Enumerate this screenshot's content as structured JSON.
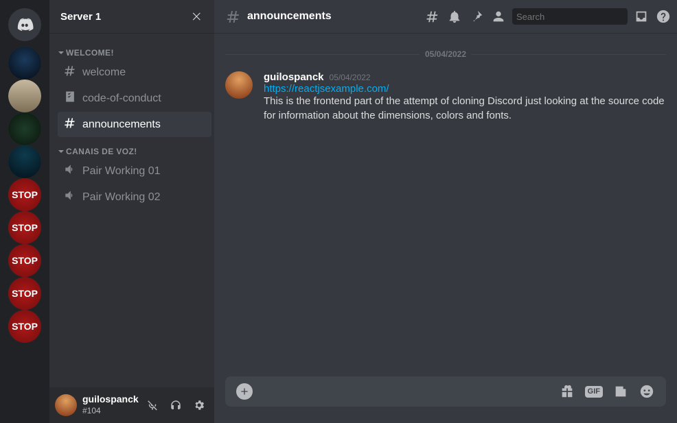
{
  "rail": {
    "home_icon": "discord-logo",
    "servers": [
      {
        "name": "server-1",
        "style": "r1",
        "label": ""
      },
      {
        "name": "server-2",
        "style": "r2",
        "label": ""
      },
      {
        "name": "server-3",
        "style": "r3",
        "label": ""
      },
      {
        "name": "server-4",
        "style": "r4",
        "label": ""
      },
      {
        "name": "server-5",
        "style": "stop",
        "label": "STOP"
      },
      {
        "name": "server-6",
        "style": "stop",
        "label": "STOP"
      },
      {
        "name": "server-7",
        "style": "stop",
        "label": "STOP"
      },
      {
        "name": "server-8",
        "style": "stop",
        "label": "STOP"
      },
      {
        "name": "server-9",
        "style": "stop",
        "label": "STOP"
      }
    ]
  },
  "server_header": {
    "title": "Server 1"
  },
  "categories": [
    {
      "label": "WELCOME!",
      "channels": [
        {
          "kind": "text",
          "label": "welcome",
          "active": false,
          "icon": "hash"
        },
        {
          "kind": "text",
          "label": "code-of-conduct",
          "active": false,
          "icon": "rules"
        },
        {
          "kind": "text",
          "label": "announcements",
          "active": true,
          "icon": "hash"
        }
      ]
    },
    {
      "label": "CANAIS DE VOZ!",
      "channels": [
        {
          "kind": "voice",
          "label": "Pair Working 01",
          "active": false,
          "icon": "speaker"
        },
        {
          "kind": "voice",
          "label": "Pair Working 02",
          "active": false,
          "icon": "speaker"
        }
      ]
    }
  ],
  "user_panel": {
    "username": "guilospanck",
    "tag": "#104"
  },
  "topbar": {
    "channel": "announcements",
    "search_placeholder": "Search"
  },
  "date_divider": "05/04/2022",
  "message": {
    "author": "guilospanck",
    "timestamp": "05/04/2022",
    "link": "https://reactjsexample.com/",
    "body": "This is the frontend part of the attempt of cloning Discord just looking at the source code for information about the dimensions, colors and fonts."
  },
  "composer": {
    "gif_label": "GIF"
  }
}
